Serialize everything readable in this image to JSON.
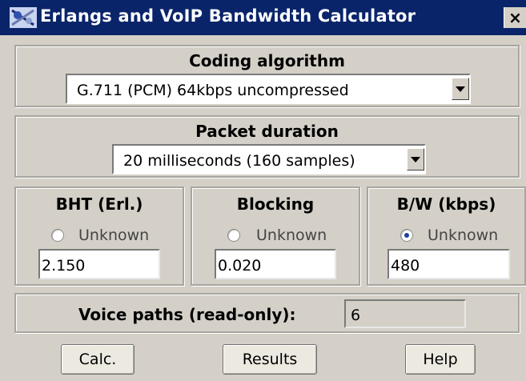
{
  "window": {
    "title": "Erlangs and VoIP Bandwidth Calculator",
    "close_label": "×"
  },
  "coding": {
    "title": "Coding algorithm",
    "selected": "G.711 (PCM) 64kbps uncompressed"
  },
  "packet": {
    "title": "Packet duration",
    "selected": "20 milliseconds (160 samples)"
  },
  "bht": {
    "title": "BHT (Erl.)",
    "radio_label": "Unknown",
    "radio_selected": false,
    "value": "2.150"
  },
  "blocking": {
    "title": "Blocking",
    "radio_label": "Unknown",
    "radio_selected": false,
    "value": "0.020"
  },
  "bandwidth": {
    "title": "B/W (kbps)",
    "radio_label": "Unknown",
    "radio_selected": true,
    "value": "480"
  },
  "voice_paths": {
    "label": "Voice paths (read-only):",
    "value": "6"
  },
  "buttons": {
    "calc": "Calc.",
    "results": "Results",
    "help": "Help"
  },
  "colors": {
    "titlebar": "#0a246a",
    "face": "#d4d0c8",
    "radio_dot": "#1e3fa0"
  }
}
